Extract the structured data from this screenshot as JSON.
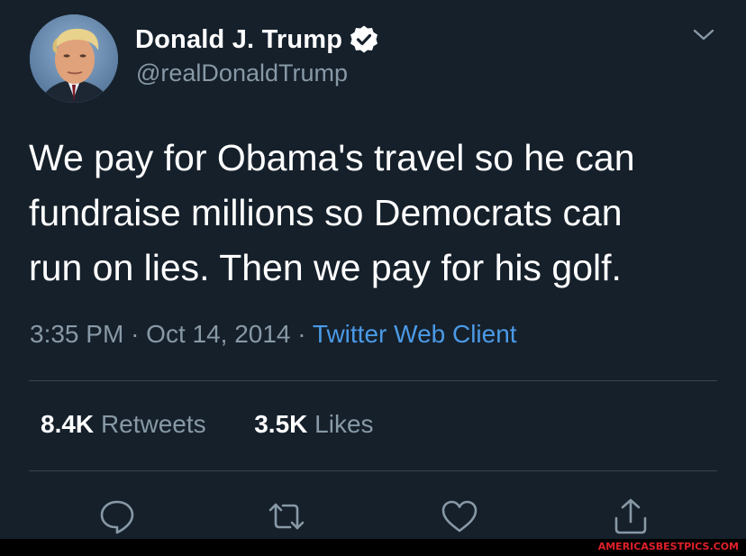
{
  "author": {
    "display_name": "Donald J. Trump",
    "handle": "@realDonaldTrump",
    "verified": true
  },
  "tweet": {
    "lines": [
      "We pay for Obama's travel so he can",
      "fundraise millions so Democrats can",
      "run on lies. Then we pay for his golf."
    ],
    "time": "3:35 PM",
    "separator": "·",
    "date": "Oct 14, 2014",
    "client": "Twitter Web Client"
  },
  "stats": {
    "retweets_count": "8.4K",
    "retweets_label": "Retweets",
    "likes_count": "3.5K",
    "likes_label": "Likes"
  },
  "actions": {
    "icons": [
      "reply-icon",
      "retweet-icon",
      "like-icon",
      "share-icon"
    ]
  },
  "watermark": "AMERICASBESTPICS.COM",
  "colors": {
    "background": "#15202b",
    "text": "#ffffff",
    "muted": "#8899a6",
    "link": "#4b9ae6",
    "divider": "#38444d"
  }
}
